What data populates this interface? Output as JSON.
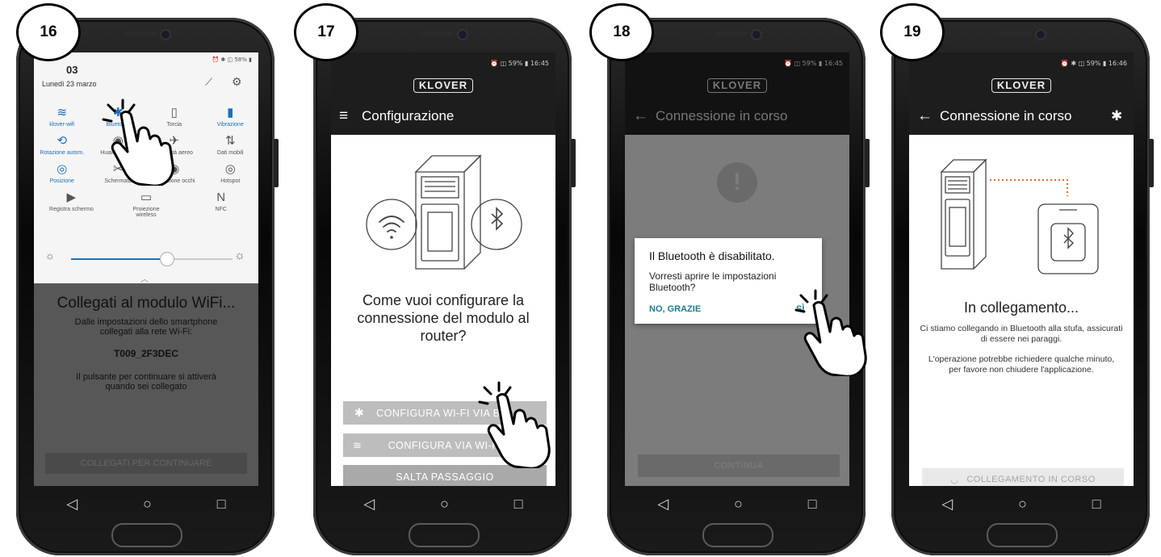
{
  "steps": [
    "16",
    "17",
    "18",
    "19"
  ],
  "phone1": {
    "status_right": "⏰ ✱ ◫ 58% ▮",
    "clock": "03",
    "date": "Lunedì 23 marzo",
    "tiles": [
      {
        "label": "klover-wifi",
        "icon": "wifi-icon"
      },
      {
        "label": "Bluetooth",
        "icon": "bluetooth-icon"
      },
      {
        "label": "Torcia",
        "icon": "flashlight-icon"
      },
      {
        "label": "Vibrazione",
        "icon": "vibration-icon"
      },
      {
        "label": "Rotazione autom.",
        "icon": "rotation-icon"
      },
      {
        "label": "Huawei Share",
        "icon": "share-icon"
      },
      {
        "label": "Modalità aereo",
        "icon": "airplane-icon"
      },
      {
        "label": "Dati mobili",
        "icon": "data-icon"
      },
      {
        "label": "Posizione",
        "icon": "location-icon"
      },
      {
        "label": "Schermata",
        "icon": "screenshot-icon"
      },
      {
        "label": "Protezione occhi",
        "icon": "eye-icon"
      },
      {
        "label": "Hotspot",
        "icon": "hotspot-icon"
      },
      {
        "label": "Registra schermo",
        "icon": "record-icon"
      },
      {
        "label": "Proiezione wireless",
        "icon": "projection-icon"
      },
      {
        "label": "NFC",
        "icon": "nfc-icon"
      }
    ],
    "bg_title": "Collegati al modulo WiFi...",
    "bg_line1": "Dalle impostazioni dello smartphone collegati alla rete Wi-Fi:",
    "network": "T009_2F3DEC",
    "bg_line2": "Il pulsante per continuare si attiverà quando sei collegato",
    "button": "COLLEGATI PER CONTINUARE",
    "brightness_level": 0.59
  },
  "phone2": {
    "status_right": "⏰ ◫ 59% ▮ 16:45",
    "logo": "KLOVER",
    "title": "Configurazione",
    "heading": "Come vuoi configurare la connessione del modulo al router?",
    "buttons": [
      "CONFIGURA WI-FI VIA BLE",
      "CONFIGURA VIA WI-FI",
      "SALTA PASSAGGIO"
    ]
  },
  "phone3": {
    "status_right": "⏰ ◫ 59% ▮ 16:45",
    "logo": "KLOVER",
    "title": "Connessione in corso",
    "dialog_title": "Il Bluetooth è disabilitato.",
    "dialog_body": "Vorresti aprire le impostazioni Bluetooth?",
    "dialog_no": "NO, GRAZIE",
    "dialog_yes": "SÌ",
    "button": "CONTINUA"
  },
  "phone4": {
    "status_right": "⏰ ✱ ◫ 59% ▮ 16:46",
    "logo": "KLOVER",
    "title": "Connessione in corso",
    "heading": "In collegamento...",
    "body1": "Ci stiamo collegando in Bluetooth alla stufa, assicurati di essere nei paraggi.",
    "body2": "L'operazione potrebbe richiedere qualche minuto, per favore non chiudere l'applicazione.",
    "button": "COLLEGAMENTO IN CORSO"
  },
  "colors": {
    "accent": "#1f6fb8",
    "appbar": "#1d1d1d",
    "orange_dots": "#e0703a"
  }
}
